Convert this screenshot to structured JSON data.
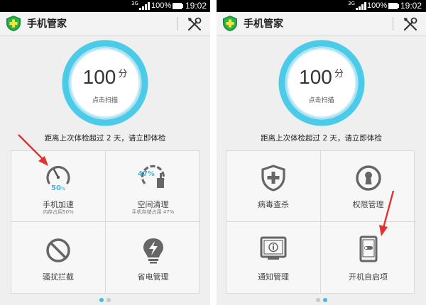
{
  "status_bar": {
    "network": "3G",
    "battery": "100%",
    "time": "19:02"
  },
  "header": {
    "title": "手机管家"
  },
  "score": {
    "value": "100",
    "unit": "分",
    "action": "点击扫描"
  },
  "notice": "距离上次体检超过 2 天，请立即体检",
  "left_screen": {
    "tiles": [
      {
        "label": "手机加速",
        "sublabel": "内存占用50%",
        "icon": "speedometer-icon",
        "badge": "50",
        "badge_unit": "%"
      },
      {
        "label": "空间清理",
        "sublabel": "手机存储占用 47%",
        "icon": "broom-icon",
        "badge": "47%"
      },
      {
        "label": "骚扰拦截",
        "icon": "block-icon"
      },
      {
        "label": "省电管理",
        "icon": "lightning-bulb-icon"
      }
    ],
    "page_indicator": {
      "pages": 2,
      "active": 1
    }
  },
  "right_screen": {
    "tiles": [
      {
        "label": "病毒查杀",
        "icon": "shield-plus-icon"
      },
      {
        "label": "权限管理",
        "icon": "keyhole-icon"
      },
      {
        "label": "通知管理",
        "icon": "info-monitor-icon"
      },
      {
        "label": "开机自启项",
        "icon": "phone-toggle-icon"
      }
    ],
    "page_indicator": {
      "pages": 2,
      "active": 2
    }
  },
  "colors": {
    "accent": "#3dbde0",
    "ring": "#5fd3ec",
    "arrow": "#e53030",
    "shield": "#21a040",
    "icon": "#666666"
  }
}
